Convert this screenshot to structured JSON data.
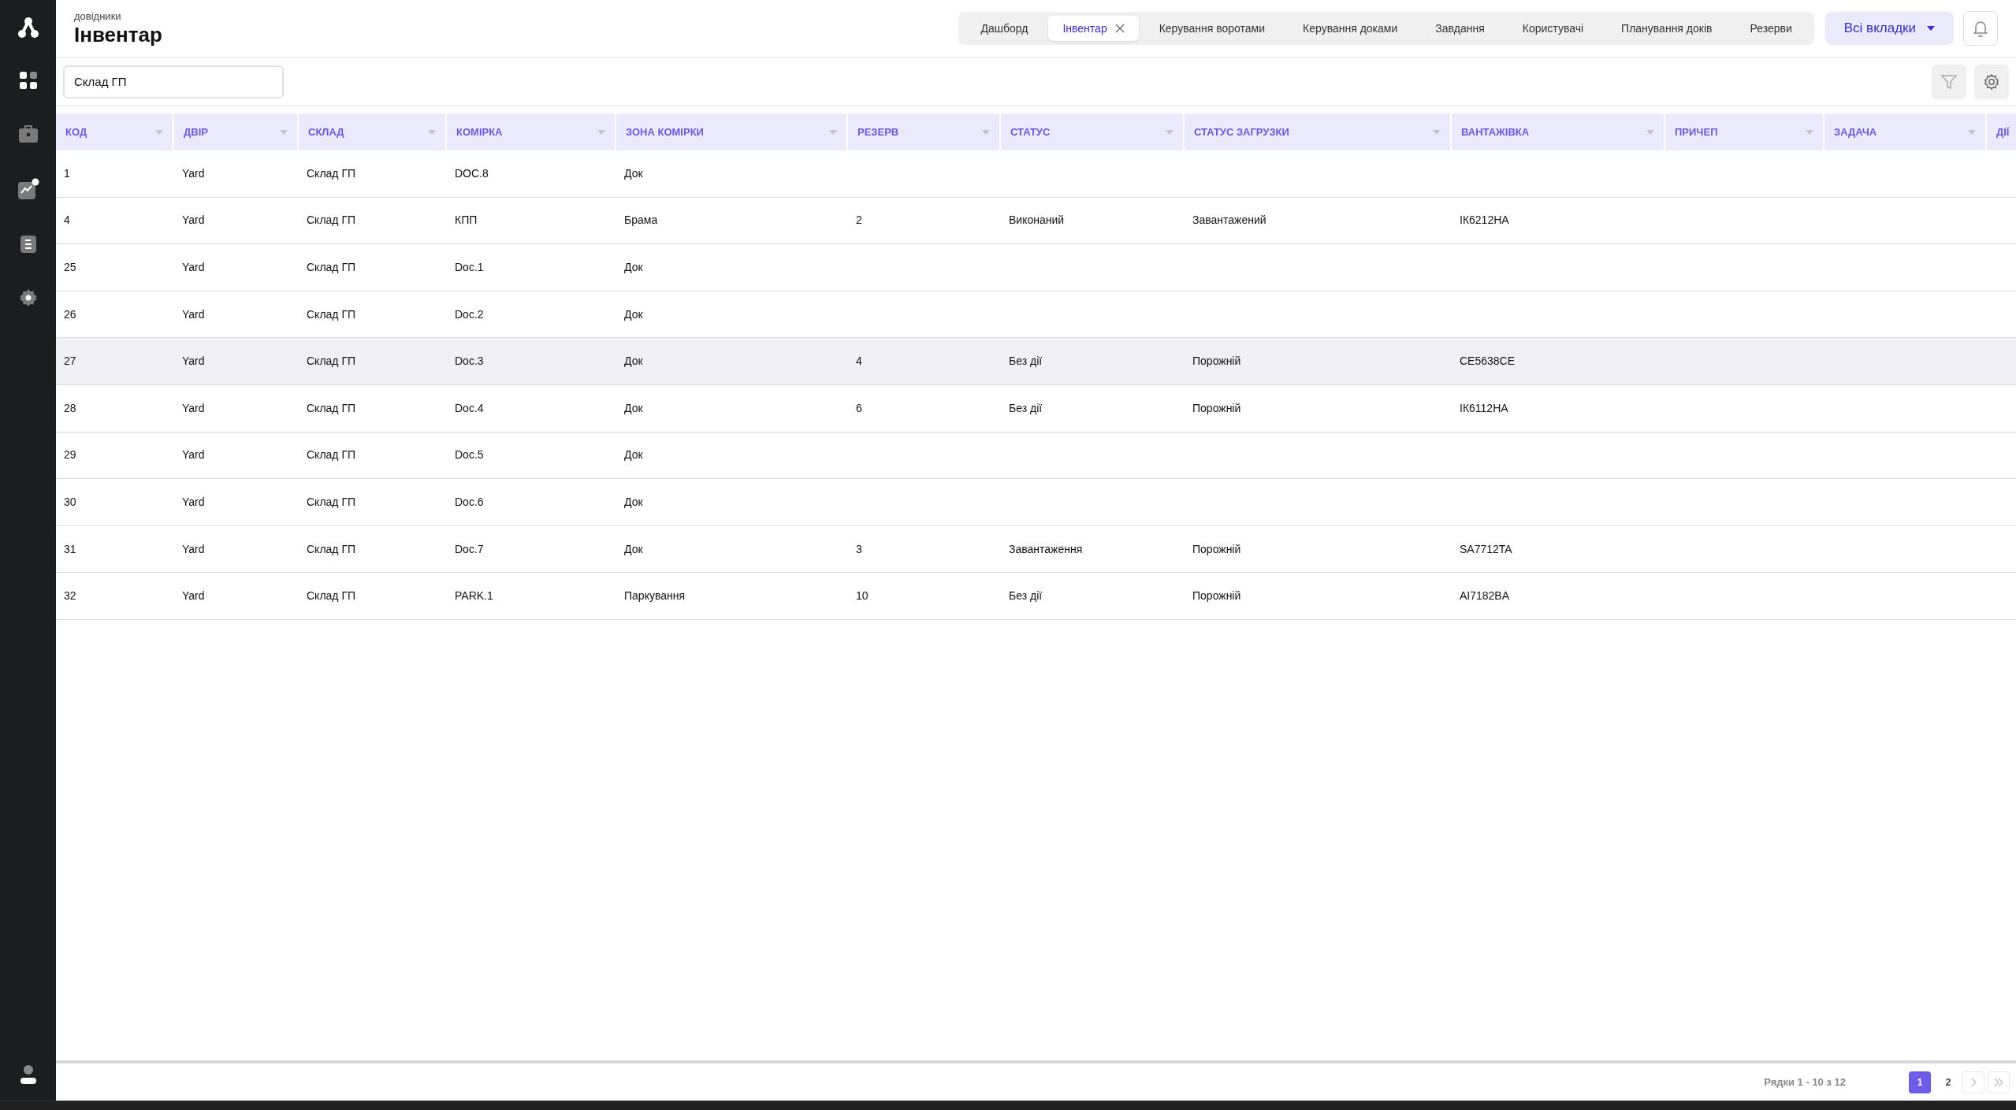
{
  "sidebar": {
    "items": [
      {
        "selected": true
      },
      {
        "selected": false
      },
      {
        "selected": false,
        "badge": true
      },
      {
        "selected": false
      },
      {
        "selected": false
      }
    ]
  },
  "header": {
    "breadcrumb": "довідники",
    "title": "Інвентар"
  },
  "tabs": [
    {
      "label": "Дашборд",
      "selected": false,
      "closable": false
    },
    {
      "label": "Інвентар",
      "selected": true,
      "closable": true
    },
    {
      "label": "Керування воротами",
      "selected": false,
      "closable": false
    },
    {
      "label": "Керування доками",
      "selected": false,
      "closable": false
    },
    {
      "label": "Завдання",
      "selected": false,
      "closable": false
    },
    {
      "label": "Користувачі",
      "selected": false,
      "closable": false
    },
    {
      "label": "Планування доків",
      "selected": false,
      "closable": false
    },
    {
      "label": "Резерви",
      "selected": false,
      "closable": false
    }
  ],
  "all_tabs_button": "Всі вкладки",
  "search": {
    "value": "Склад ГП"
  },
  "table": {
    "columns": [
      "КОД",
      "ДВІР",
      "СКЛАД",
      "КОМІРКА",
      "ЗОНА КОМІРКИ",
      "РЕЗЕРВ",
      "СТАТУС",
      "СТАТУС ЗАГРУЗКИ",
      "ВАНТАЖІВКА",
      "ПРИЧЕП",
      "ЗАДАЧА",
      "ДІЇ"
    ],
    "rows": [
      {
        "selected": false,
        "cells": [
          "1",
          "Yard",
          "Склад ГП",
          "DOC.8",
          "Док"
        ]
      },
      {
        "selected": false,
        "cells": [
          "4",
          "Yard",
          "Склад ГП",
          "КПП",
          "Брама",
          "2",
          "Виконаний",
          "Завантажений",
          "ІК6212НА"
        ]
      },
      {
        "selected": false,
        "cells": [
          "25",
          "Yard",
          "Склад ГП",
          "Doc.1",
          "Док"
        ]
      },
      {
        "selected": false,
        "cells": [
          "26",
          "Yard",
          "Склад ГП",
          "Doc.2",
          "Док"
        ]
      },
      {
        "selected": true,
        "cells": [
          "27",
          "Yard",
          "Склад ГП",
          "Doc.3",
          "Док",
          "4",
          "Без дії",
          "Порожній",
          "СЕ5638СЕ"
        ]
      },
      {
        "selected": false,
        "cells": [
          "28",
          "Yard",
          "Склад ГП",
          "Doc.4",
          "Док",
          "6",
          "Без дії",
          "Порожній",
          "ІК6112НА"
        ]
      },
      {
        "selected": false,
        "cells": [
          "29",
          "Yard",
          "Склад ГП",
          "Doc.5",
          "Док"
        ]
      },
      {
        "selected": false,
        "cells": [
          "30",
          "Yard",
          "Склад ГП",
          "Doc.6",
          "Док"
        ]
      },
      {
        "selected": false,
        "cells": [
          "31",
          "Yard",
          "Склад ГП",
          "Doc.7",
          "Док",
          "3",
          "Завантаження",
          "Порожній",
          "SA7712TA"
        ]
      },
      {
        "selected": false,
        "cells": [
          "32",
          "Yard",
          "Склад ГП",
          "PARK.1",
          "Паркування",
          "10",
          "Без дії",
          "Порожній",
          "AI7182BA"
        ]
      }
    ]
  },
  "footer": {
    "rows_info": "Рядки 1 - 10 з 12",
    "pages": [
      {
        "label": "1",
        "selected": true
      },
      {
        "label": "2",
        "selected": false
      }
    ]
  }
}
